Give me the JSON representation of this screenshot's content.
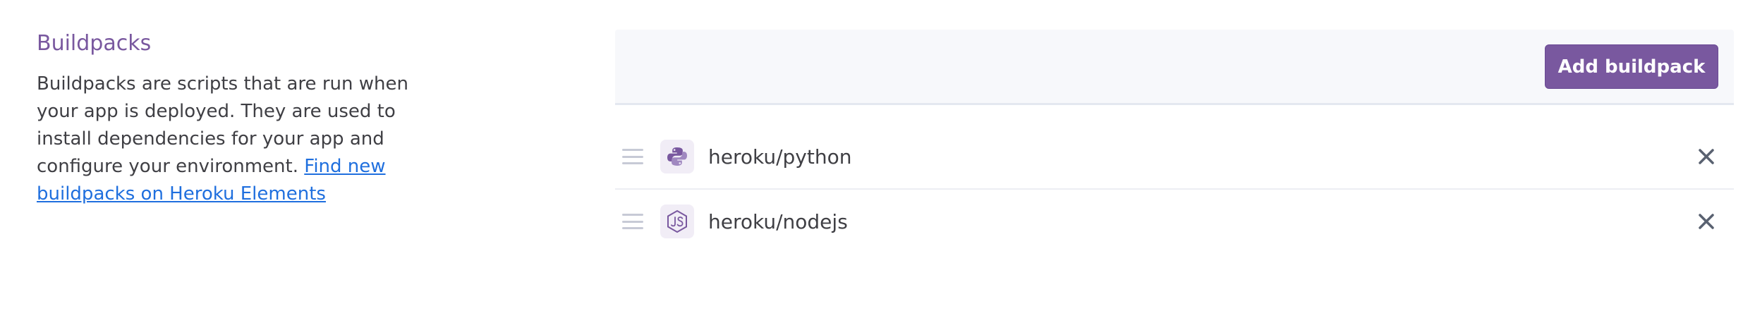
{
  "section": {
    "title": "Buildpacks",
    "description": "Buildpacks are scripts that are run when your app is deployed. They are used to install dependencies for your app and configure your environment.",
    "link_text": "Find new buildpacks on Heroku Elements"
  },
  "toolbar": {
    "add_label": "Add buildpack"
  },
  "buildpacks": [
    {
      "name": "heroku/python",
      "icon": "python-icon"
    },
    {
      "name": "heroku/nodejs",
      "icon": "nodejs-icon"
    }
  ],
  "colors": {
    "accent": "#79589f",
    "link": "#1f6fde",
    "text": "#3f3f44",
    "panel_bg": "#f7f8fb"
  }
}
